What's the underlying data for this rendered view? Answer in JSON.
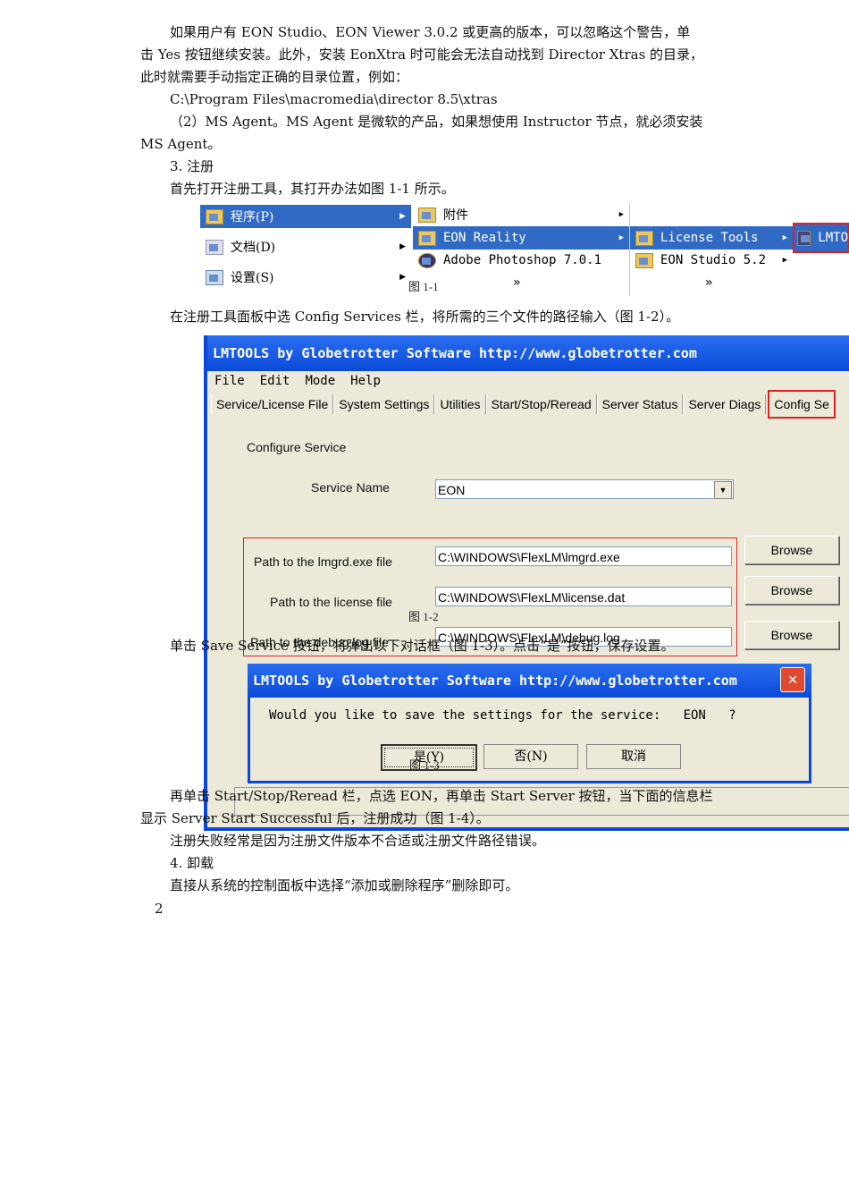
{
  "paragraphs": {
    "p1a": "如果用户有 EON Studio、EON Viewer 3.0.2 或更高的版本，可以忽略这个警告，单",
    "p1b": "击 Yes 按钮继续安装。此外，安装 EonXtra 时可能会无法自动找到 Director Xtras 的目录，",
    "p1c": "此时就需要手动指定正确的目录位置，例如：",
    "p2": "C:\\Program Files\\macromedia\\director 8.5\\xtras",
    "p3a": "（2）MS Agent。MS Agent 是微软的产品，如果想使用 Instructor 节点，就必须安装",
    "p3b": "MS Agent。",
    "p4": "3. 注册",
    "p5": "首先打开注册工具，其打开办法如图 1-1 所示。",
    "p6": "在注册工具面板中选 Config Services 栏，将所需的三个文件的路径输入（图 1-2）。",
    "p7": "单击 Save Service 按钮，将弹出以下对话框（图 1-3）。点击“是”按钮，保存设置。",
    "p8a": "再单击 Start/Stop/Reread 栏，点选 EON，再单击 Start Server 按钮，当下面的信息栏",
    "p8b": "显示 Server Start Successful 后，注册成功（图 1-4）。",
    "p9": "注册失败经常是因为注册文件版本不合适或注册文件路径错误。",
    "p10": "4. 卸载",
    "p11": "直接从系统的控制面板中选择“添加或删除程序”删除即可。",
    "page_number": "2"
  },
  "captions": {
    "fig1": "图 1-1",
    "fig2": "图 1-2",
    "fig3": "图 1-3"
  },
  "start_menu": {
    "col1": [
      "程序(P)",
      "文档(D)",
      "设置(S)"
    ],
    "col2": [
      "附件",
      "EON Reality",
      "Adobe Photoshop 7.0.1"
    ],
    "col3": [
      "License Tools",
      "EON Studio 5.2"
    ],
    "col4": "LMTO",
    "more": "»"
  },
  "lmtools": {
    "title": "LMTOOLS by Globetrotter Software http://www.globetrotter.com",
    "menu": [
      "File",
      "Edit",
      "Mode",
      "Help"
    ],
    "tabs": [
      "Service/License File",
      "System Settings",
      "Utilities",
      "Start/Stop/Reread",
      "Server Status",
      "Server Diags",
      "Config Se"
    ],
    "section": "Configure Service",
    "service_name_label": "Service Name",
    "service_name": "EON",
    "lmgrd_label": "Path to the lmgrd.exe file",
    "lmgrd": "C:\\WINDOWS\\FlexLM\\lmgrd.exe",
    "license_label": "Path to the license file",
    "license": "C:\\WINDOWS\\FlexLM\\license.dat",
    "debug_label": "Path to the debug log file",
    "debug": "C:\\WINDOWS\\FlexLM\\debug.log",
    "browse": "Browse"
  },
  "dialog": {
    "title": "LMTOOLS by Globetrotter Software http://www.globetrotter.com",
    "message": "Would you like to save the settings for the service:   EON   ?",
    "yes": "是(Y)",
    "no": "否(N)",
    "cancel": "取消"
  },
  "colors": {
    "highlight": "#316ac5",
    "titlebar": "#0a4ad8",
    "red_box": "#e02020"
  }
}
